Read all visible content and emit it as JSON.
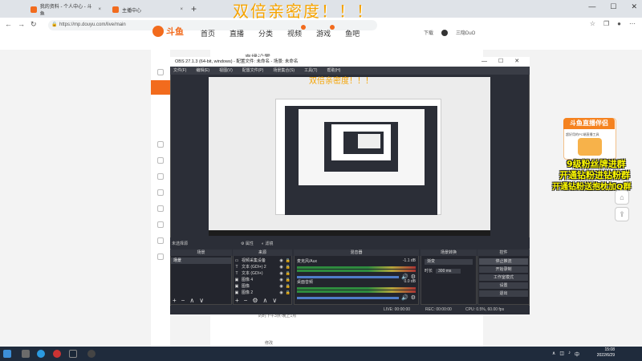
{
  "browser": {
    "tabs": [
      {
        "label": "我的资料 - 个人中心 - 斗鱼",
        "active": false
      },
      {
        "label": "我的资料 - 个人中心 - 斗鱼",
        "active": false
      },
      {
        "label": "主播中心",
        "active": true
      }
    ],
    "url": "https://mp.douyu.com/live/main"
  },
  "overlay_title": "双倍亲密度！！！",
  "site": {
    "logo_text": "斗鱼",
    "nav": [
      "首页",
      "直播",
      "分类",
      "视频",
      "游戏",
      "鱼吧"
    ],
    "user": {
      "download": "下载",
      "name": "三隐DuO"
    },
    "page_title": "直播设置",
    "bottom_text": "的时下午3点-晚上1点",
    "bottom_text2": "修改"
  },
  "obs": {
    "title": "OBS 27.1.3 (64-bit, windows) - 配置文件: 未命名 - 场景: 未命名",
    "menu": [
      "文件(F)",
      "编辑(E)",
      "视图(V)",
      "配置文件(P)",
      "场景集合(S)",
      "工具(T)",
      "帮助(H)"
    ],
    "preview_title": "双倍亲密度！！！",
    "no_source": "未选择源",
    "properties_label": "属性",
    "filters_label": "滤镜",
    "docks": {
      "scenes": "场景",
      "sources": "来源",
      "mixer": "混音器",
      "transitions": "场景转换",
      "controls": "控件"
    },
    "scene_items": [
      "场景"
    ],
    "source_items": [
      {
        "icon": "monitor-icon",
        "label": "视频采集设备"
      },
      {
        "icon": "text-icon",
        "label": "文本 (GDI+) 2"
      },
      {
        "icon": "text-icon",
        "label": "文本 (GDI+)"
      },
      {
        "icon": "image-icon",
        "label": "图像 4"
      },
      {
        "icon": "image-icon",
        "label": "图像"
      },
      {
        "icon": "image-icon",
        "label": "图像 2"
      }
    ],
    "mixer": [
      {
        "name": "麦克风/Aux",
        "db": "-1.1 dB"
      },
      {
        "name": "桌面音频",
        "db": "0.0 dB"
      }
    ],
    "transition": {
      "type": "渐变",
      "duration_label": "时长",
      "duration": "300 ms"
    },
    "controls": [
      "停止推流",
      "开始录制",
      "工作室模式",
      "设置",
      "退出"
    ],
    "status": {
      "live": "LIVE: 00:00:00",
      "rec": "REC: 00:00:00",
      "cpu": "CPU: 0.5%, 60.00 fps"
    }
  },
  "promo": {
    "title": "斗鱼直播伴侣",
    "subtitle": "超好用的PC端直播工具",
    "overlay_lines": [
      "9级粉丝牌进群",
      "开通钻粉进钻粉群",
      "开通钻粉送抱枕加Q群"
    ]
  },
  "taskbar": {
    "time": "15:08",
    "date": "2022/6/29"
  },
  "colors": {
    "brand": "#f26b1d",
    "obs_bg": "#2b2e37",
    "overlay_yellow": "#fffb00"
  }
}
